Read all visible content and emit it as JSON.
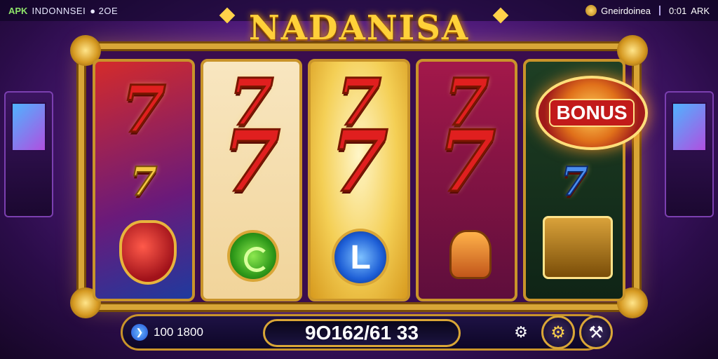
{
  "status_bar": {
    "left_apk": "APK",
    "left_brand": "INDONNSEI",
    "left_extra": "● 2OE",
    "right_label": "Gneirdoinea",
    "right_time": "0:01",
    "right_apk": "ARK"
  },
  "game": {
    "title": "NADANISA",
    "bonus_label": "BONUS"
  },
  "reels": {
    "reel1": {
      "top": "7",
      "mid": "7"
    },
    "reel2": {
      "top": "7",
      "mid": "7"
    },
    "reel3": {
      "top": "7",
      "mid": "7"
    },
    "reel4": {
      "top": "7",
      "mid": "7"
    },
    "reel5": {
      "mid": "7"
    }
  },
  "bottom_bar": {
    "balance_icon": "❯",
    "balance": "100 1800",
    "display": "9O162/61 33",
    "gear_glyph": "⚙",
    "settings_glyph": "⚙",
    "hammer_glyph": "⚒"
  },
  "icons": {
    "settings": "gear-icon",
    "tools": "hammer-icon",
    "balance": "coin-icon"
  },
  "colors": {
    "title": "#ffd23a",
    "frame_gold": "#d8a637",
    "seven_red": "#e01f1f",
    "background": "#5a1f8c"
  }
}
